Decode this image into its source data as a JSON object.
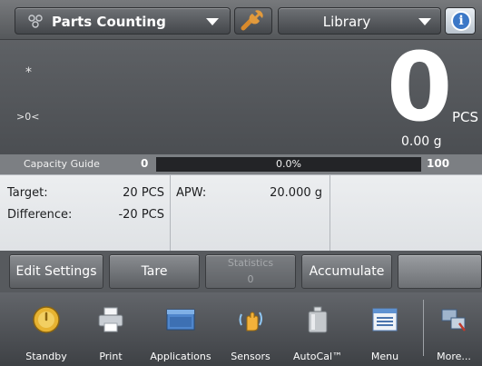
{
  "header": {
    "application_label": "Parts Counting",
    "library_label": "Library"
  },
  "display": {
    "stable_indicator": "*",
    "center_zero_indicator": ">0<",
    "count": "0",
    "count_unit": "PCS",
    "secondary_weight": "0.00 g"
  },
  "capacity_guide": {
    "label": "Capacity Guide",
    "min": "0",
    "percent_text": "0.0%",
    "max": "100",
    "fill_fraction": 0.0,
    "fill_color": "#6fbf4a"
  },
  "info": {
    "target_label": "Target:",
    "target_value": "20 PCS",
    "difference_label": "Difference:",
    "difference_value": "-20 PCS",
    "apw_label": "APW:",
    "apw_value": "20.000 g"
  },
  "softkeys": {
    "edit_settings": "Edit Settings",
    "tare": "Tare",
    "statistics_label": "Statistics",
    "statistics_value": "0",
    "accumulate": "Accumulate"
  },
  "nav": {
    "standby": "Standby",
    "print": "Print",
    "applications": "Applications",
    "sensors": "Sensors",
    "autocal": "AutoCal™",
    "menu": "Menu",
    "more": "More..."
  },
  "icons": {
    "app": "parts-counting-icon",
    "wrench": "wrench-icon",
    "info": "info-icon"
  }
}
